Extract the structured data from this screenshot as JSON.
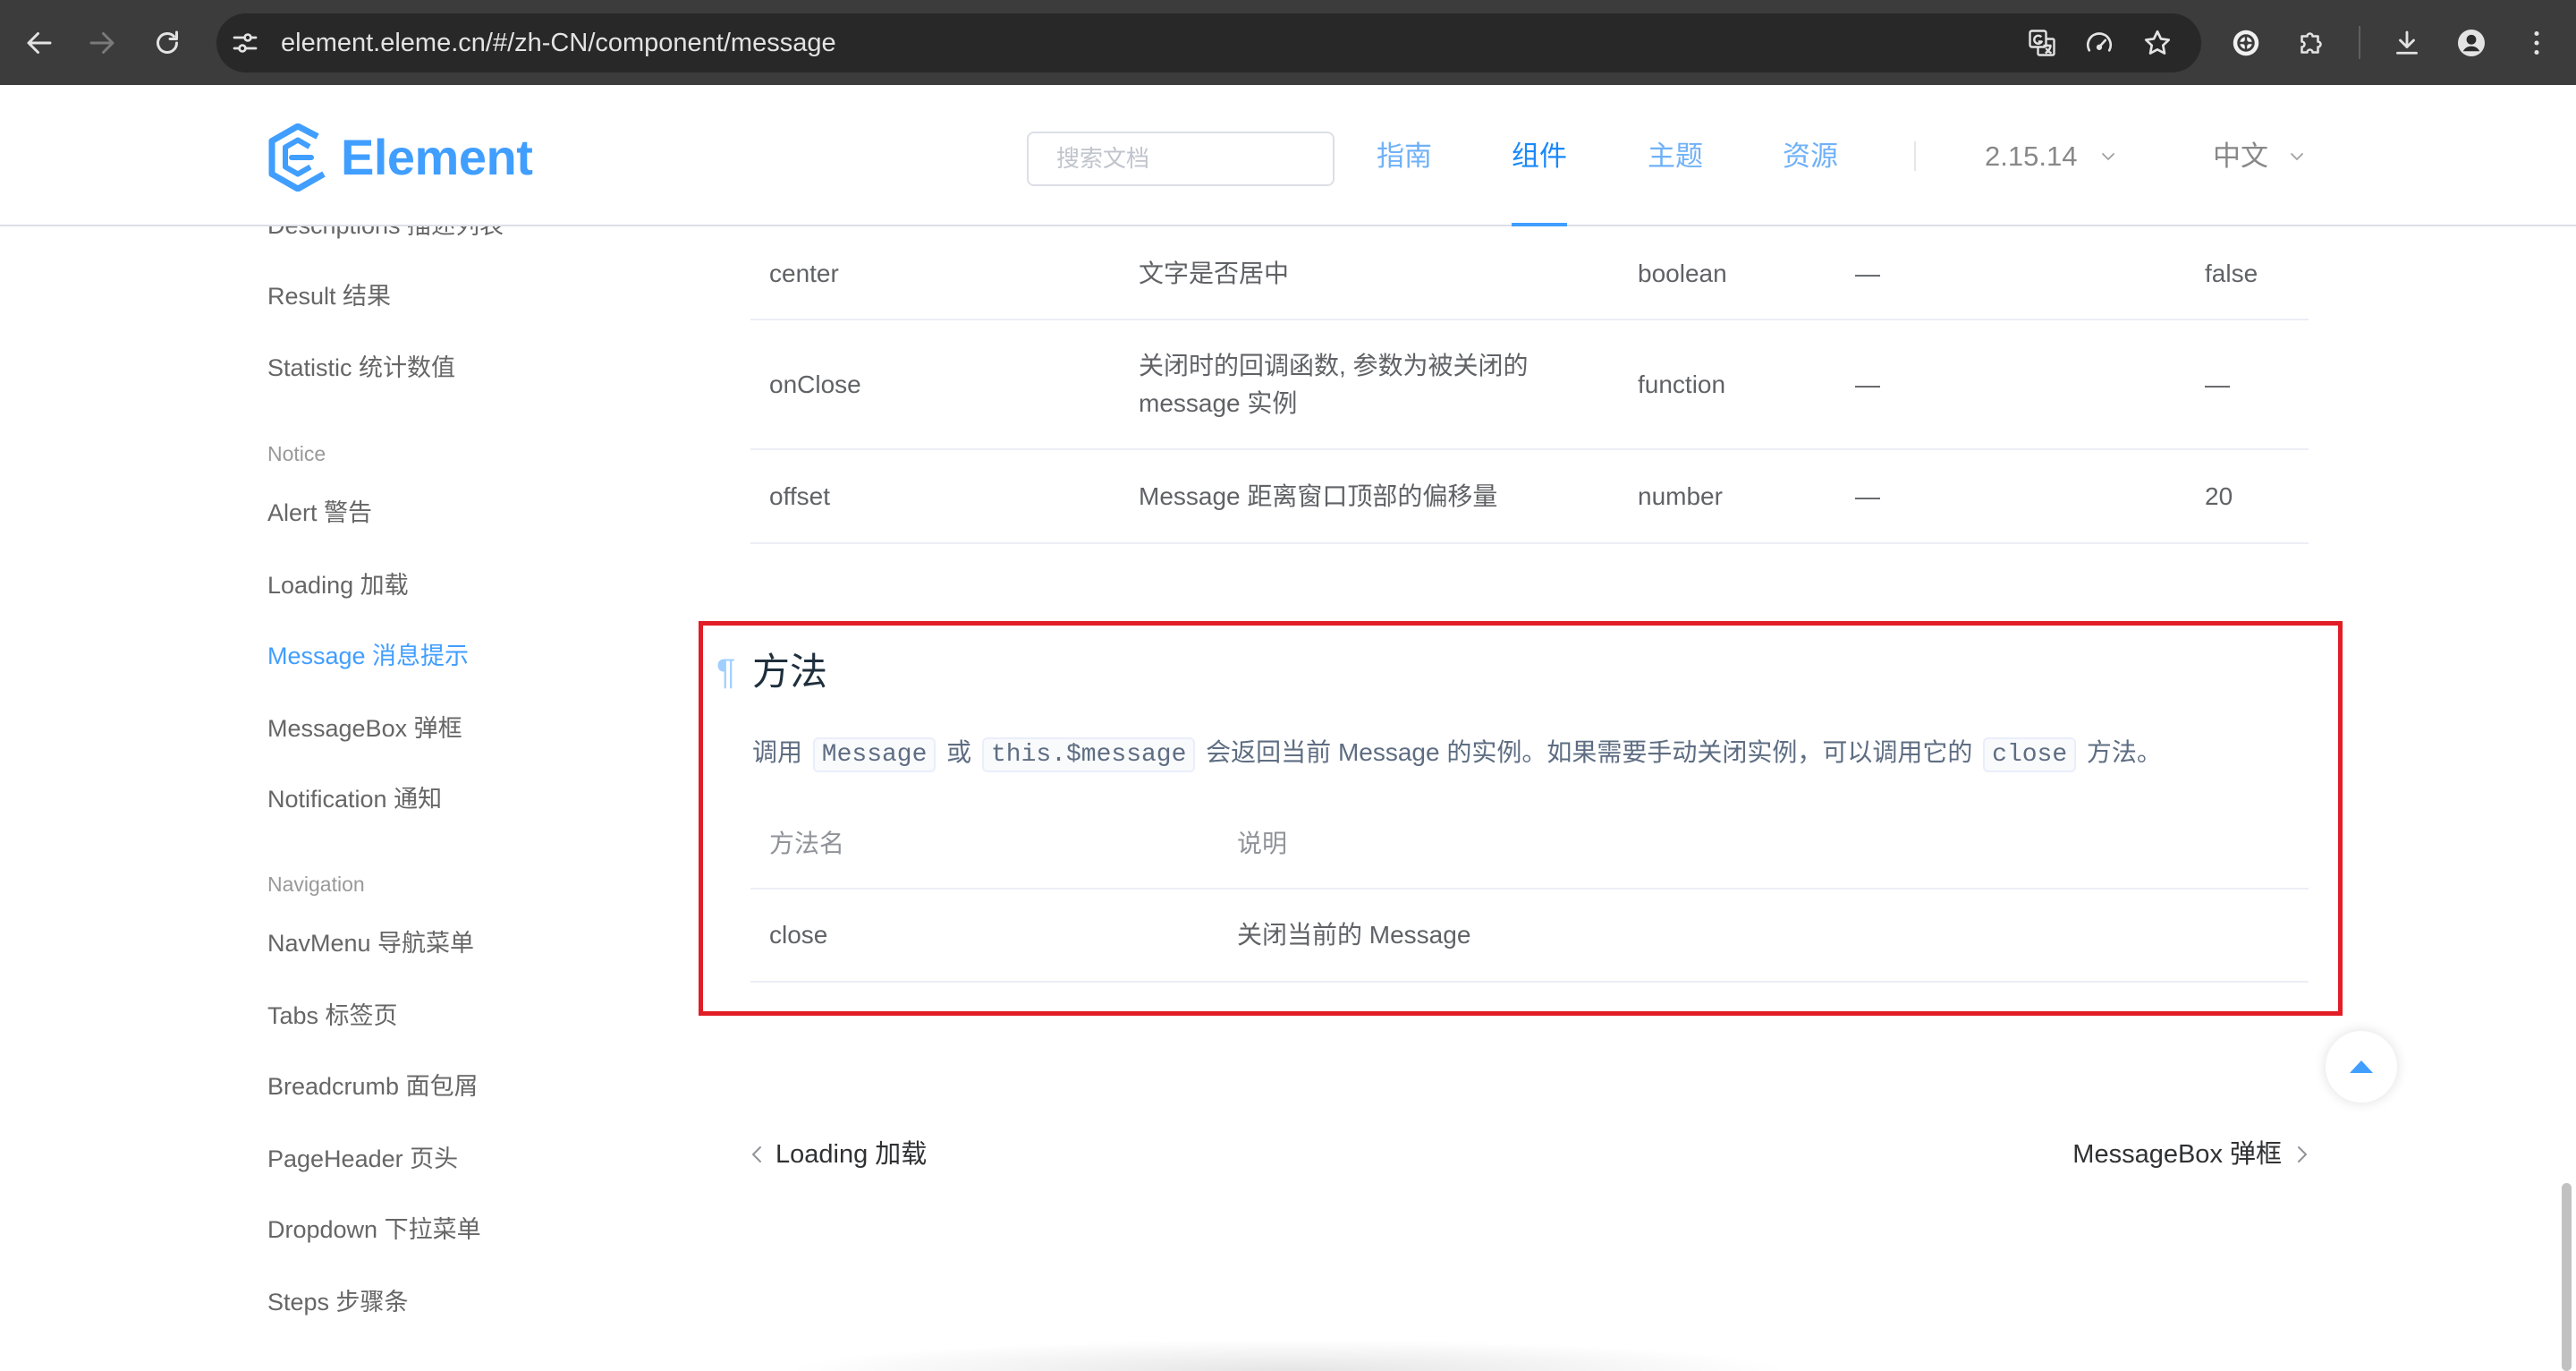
{
  "browser": {
    "url": "element.eleme.cn/#/zh-CN/component/message",
    "icons": {
      "back": "back-arrow-icon",
      "forward": "forward-arrow-icon",
      "reload": "reload-icon",
      "site_info": "site-info-icon",
      "translate": "translate-icon",
      "performance": "performance-icon",
      "bookmark": "bookmark-star-icon",
      "extension": "extension-icon",
      "extensions_menu": "puzzle-icon",
      "downloads": "download-icon",
      "profile": "profile-icon",
      "menu": "more-menu-icon"
    }
  },
  "header": {
    "logo_text": "Element",
    "search_placeholder": "搜索文档",
    "nav": [
      {
        "label": "指南",
        "active": false
      },
      {
        "label": "组件",
        "active": true
      },
      {
        "label": "主题",
        "active": false
      },
      {
        "label": "资源",
        "active": false
      }
    ],
    "version": "2.15.14",
    "language": "中文"
  },
  "sidebar": {
    "items": [
      {
        "label": "Descriptions 描述列表",
        "group": false
      },
      {
        "label": "Result 结果",
        "group": false
      },
      {
        "label": "Statistic 统计数值",
        "group": false
      },
      {
        "label": "Notice",
        "group": true
      },
      {
        "label": "Alert 警告",
        "group": false
      },
      {
        "label": "Loading 加载",
        "group": false
      },
      {
        "label": "Message 消息提示",
        "group": false,
        "active": true
      },
      {
        "label": "MessageBox 弹框",
        "group": false
      },
      {
        "label": "Notification 通知",
        "group": false
      },
      {
        "label": "Navigation",
        "group": true
      },
      {
        "label": "NavMenu 导航菜单",
        "group": false
      },
      {
        "label": "Tabs 标签页",
        "group": false
      },
      {
        "label": "Breadcrumb 面包屑",
        "group": false
      },
      {
        "label": "PageHeader 页头",
        "group": false
      },
      {
        "label": "Dropdown 下拉菜单",
        "group": false
      },
      {
        "label": "Steps 步骤条",
        "group": false
      }
    ]
  },
  "attributes_table": {
    "rows": [
      [
        "center",
        "文字是否居中",
        "boolean",
        "—",
        "false"
      ],
      [
        "onClose",
        "关闭时的回调函数, 参数为被关闭的 message 实例",
        "function",
        "—",
        "—"
      ],
      [
        "offset",
        "Message 距离窗口顶部的偏移量",
        "number",
        "—",
        "20"
      ]
    ]
  },
  "methods": {
    "anchor": "¶",
    "title": "方法",
    "description": [
      {
        "code": false,
        "value": "调用 "
      },
      {
        "code": true,
        "value": "Message"
      },
      {
        "code": false,
        "value": " 或 "
      },
      {
        "code": true,
        "value": "this.$message"
      },
      {
        "code": false,
        "value": " 会返回当前 Message 的实例。如果需要手动关闭实例，可以调用它的 "
      },
      {
        "code": true,
        "value": "close"
      },
      {
        "code": false,
        "value": " 方法。"
      }
    ],
    "table": {
      "headers": [
        "方法名",
        "说明"
      ],
      "rows": [
        [
          "close",
          "关闭当前的 Message"
        ]
      ]
    }
  },
  "pager": {
    "prev": "Loading 加载",
    "next": "MessageBox 弹框"
  },
  "colors": {
    "brand": "#409EFF",
    "nav_active": "#1989fa",
    "highlight_box": "#e11d26",
    "table_text": "#606266",
    "chrome_bar": "#3c3c3c",
    "omnibox": "#282828"
  }
}
